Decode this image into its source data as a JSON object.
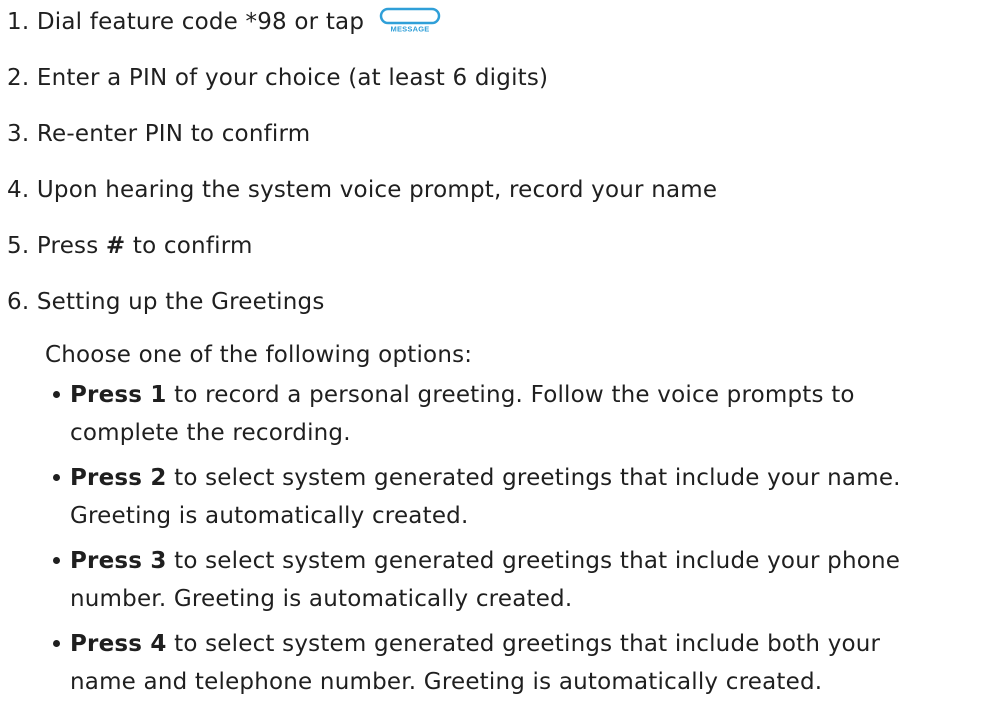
{
  "steps": [
    {
      "number": "1.",
      "text": "Dial feature code *98 or tap"
    },
    {
      "number": "2.",
      "text": "Enter a PIN of your choice (at least 6 digits)"
    },
    {
      "number": "3.",
      "text": "Re-enter PIN to confirm"
    },
    {
      "number": "4.",
      "text": "Upon hearing the system voice prompt, record your name"
    },
    {
      "number": "5.",
      "prefix": "Press ",
      "bold": "#",
      "suffix": " to confirm"
    },
    {
      "number": "6.",
      "text": "Setting up the Greetings"
    }
  ],
  "message_key": {
    "label": "MESSAGE",
    "icon": "message-key-icon",
    "color": "#2f9fd8"
  },
  "greetings": {
    "intro": "Choose one of the following options:",
    "options": [
      {
        "bold": "Press 1",
        "line1": " to record a personal greeting. Follow the voice prompts to",
        "line2": "complete the recording."
      },
      {
        "bold": "Press 2",
        "line1": " to select system generated greetings that include your name.",
        "line2": "Greeting is automatically created."
      },
      {
        "bold": "Press 3",
        "line1": " to select system generated greetings that include your phone",
        "line2": "number. Greeting is automatically created."
      },
      {
        "bold": "Press 4",
        "line1": " to select system generated greetings that include both your",
        "line2": "name and telephone number. Greeting is automatically created."
      }
    ]
  }
}
